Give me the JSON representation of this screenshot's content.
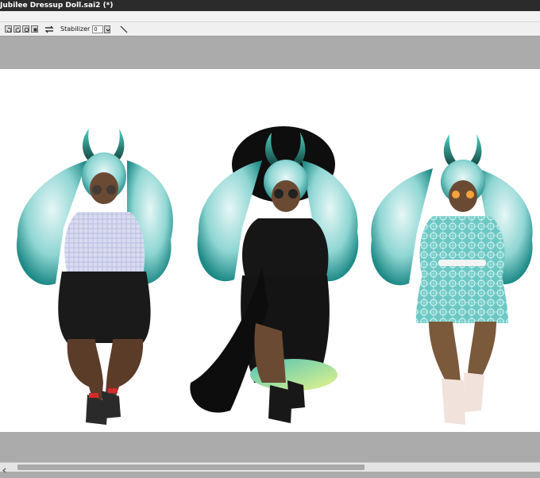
{
  "window": {
    "title": "Jubilee Dressup Doll.sai2 (*)"
  },
  "toolbar": {
    "stabilizer_label": "Stabilizer",
    "stabilizer_value": "0"
  },
  "icons": [
    "undo-icon",
    "redo-icon",
    "stop-icon",
    "swap-colors-icon",
    "dropdown-icon",
    "pen-line-icon"
  ],
  "canvas": {
    "content": "three dress-up doll variants of a dark-skinned character with teal hair and teal horns",
    "outfits": [
      {
        "name": "plaid-sweater-black-skirt",
        "colors": {
          "top": "#cfd3ea",
          "skirt": "#1a1a1a",
          "shoes": "#2a2a2a"
        }
      },
      {
        "name": "black-witch-dress-and-hat",
        "colors": {
          "dress": "#141414",
          "hat": "#0e0e0e",
          "boots": "#181818"
        }
      },
      {
        "name": "teal-pattern-dress",
        "colors": {
          "dress": "#7fd1cd",
          "boots": "#f1e2dc"
        }
      }
    ]
  },
  "colors": {
    "hair": "#6fc7c5",
    "horns": "#1b6a63",
    "skin": "#6b4a33",
    "titlebar": "#2b2b2b",
    "workspace": "#ababab"
  },
  "scrollbar": {
    "position": 0.03,
    "visible_fraction": 0.64
  }
}
